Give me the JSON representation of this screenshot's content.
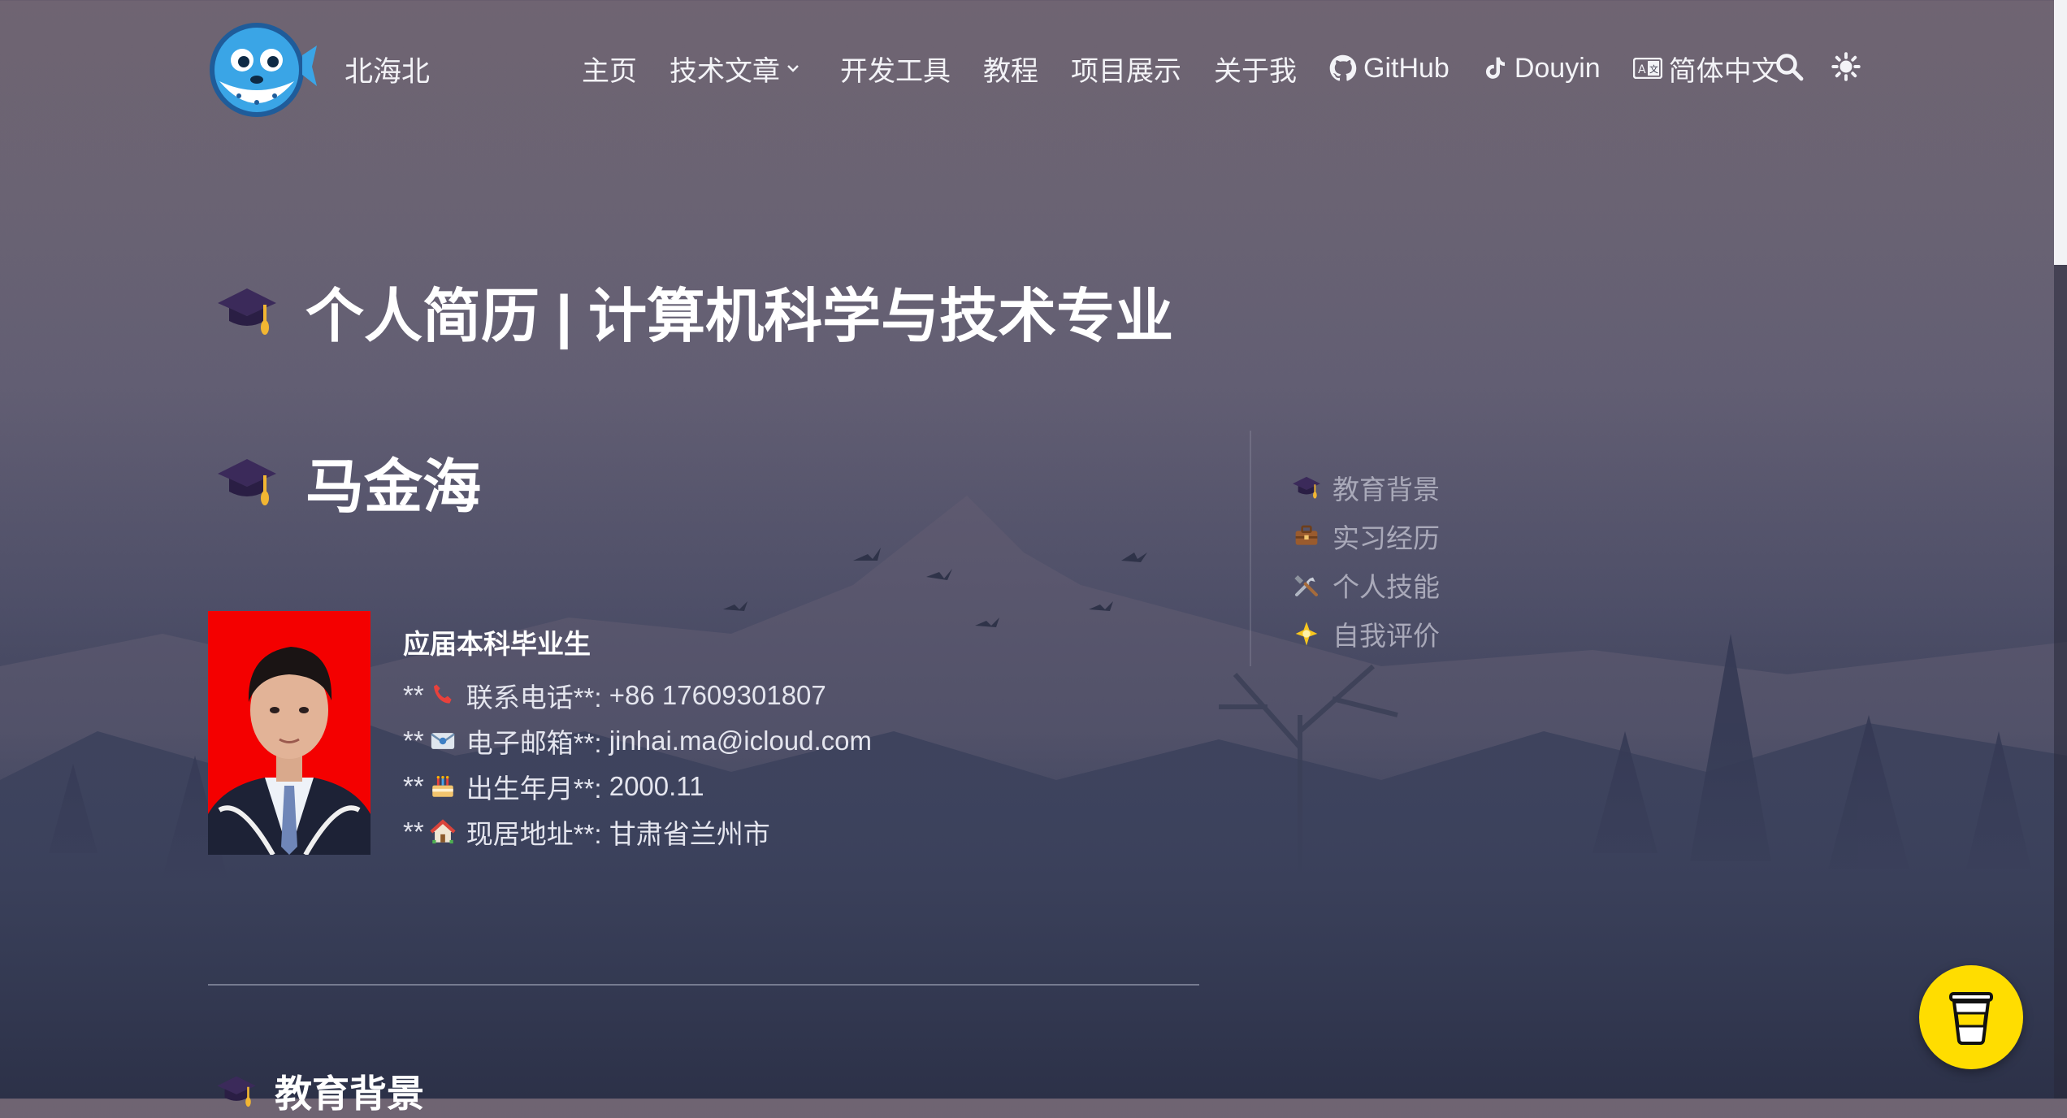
{
  "header": {
    "site_title": "北海北",
    "nav": {
      "home": "主页",
      "articles": "技术文章",
      "dev_tools": "开发工具",
      "tutorials": "教程",
      "projects": "项目展示",
      "about": "关于我",
      "github": "GitHub",
      "douyin": "Douyin",
      "language": "简体中文"
    },
    "icons": [
      "logo-pufferfish",
      "chevron-down-icon",
      "github-icon",
      "tiktok-icon",
      "translate-icon",
      "search-icon",
      "theme-toggle-icon"
    ]
  },
  "page": {
    "title": "个人简历 | 计算机科学与技术专业",
    "name": "马金海",
    "subtitle": "应届本科毕业生",
    "contact": [
      {
        "prefix": "**",
        "icon": "phone-icon",
        "label": "联系电话**:",
        "value": "+86 17609301807"
      },
      {
        "prefix": "**",
        "icon": "email-icon",
        "label": "电子邮箱**:",
        "value": "jinhai.ma@icloud.com"
      },
      {
        "prefix": "**",
        "icon": "birthday-cake-icon",
        "label": "出生年月**:",
        "value": "2000.11"
      },
      {
        "prefix": "**",
        "icon": "house-icon",
        "label": "现居地址**:",
        "value": "甘肃省兰州市"
      }
    ],
    "next_section": "教育背景"
  },
  "toc": [
    {
      "icon": "graduation-cap-icon",
      "label": "教育背景"
    },
    {
      "icon": "briefcase-icon",
      "label": "实习经历"
    },
    {
      "icon": "tools-icon",
      "label": "个人技能"
    },
    {
      "icon": "sparkle-icon",
      "label": "自我评价"
    }
  ],
  "colors": {
    "accent_yellow": "#ffdd00",
    "photo_background": "#f40000",
    "text_primary": "#ffffff",
    "text_toc": "#a9a9b9"
  },
  "floating": {
    "icon": "coffee-cup-icon"
  }
}
